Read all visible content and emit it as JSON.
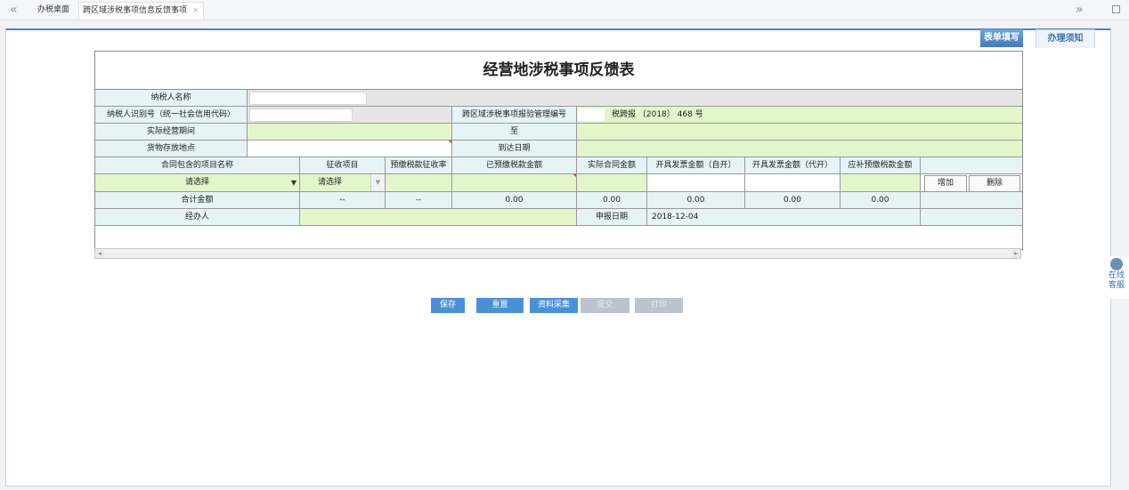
{
  "topbar": {
    "back_icon": "double-chevron-left",
    "tabs": [
      {
        "label": "办税桌面"
      },
      {
        "label": "跨区域涉税事项信息反馈事项",
        "close": "×"
      }
    ],
    "forward_icon": "double-chevron-right"
  },
  "right_tabs": {
    "fill": "表单填写",
    "notice": "办理须知"
  },
  "form": {
    "title": "经营地涉税事项反馈表",
    "taxpayer_name_label": "纳税人名称",
    "taxpayer_id_label": "纳税人识别号（统一社会信用代码）",
    "mgmt_no_label": "跨区域涉税事项报验管理编号",
    "mgmt_no_value": "税跨报 〔2018〕 468 号",
    "period_label": "实际经营期间",
    "to_label": "至",
    "storage_label": "货物存放地点",
    "arrival_label": "到达日期",
    "headers": [
      "合同包含的项目名称",
      "征收项目",
      "预缴税款征收率",
      "已预缴税款金额",
      "实际合同金额",
      "开具发票金额（自开）",
      "开具发票金额（代开）",
      "应补预缴税款金额"
    ],
    "row": {
      "project_select": "请选择",
      "levy_select": "请选择",
      "add_btn": "增加",
      "del_btn": "删除"
    },
    "total": {
      "label": "合计金额",
      "c1": "--",
      "c2": "--",
      "c3": "0.00",
      "c4": "0.00",
      "c5": "0.00",
      "c6": "0.00",
      "c7": "0.00"
    },
    "handler_label": "经办人",
    "date_label": "申报日期",
    "date_value": "2018-12-04"
  },
  "buttons": {
    "save": "保存",
    "reset": "重置",
    "collect": "资料采集",
    "submit": "提交",
    "print": "打印"
  },
  "support": {
    "line1": "在线",
    "line2": "客服"
  }
}
